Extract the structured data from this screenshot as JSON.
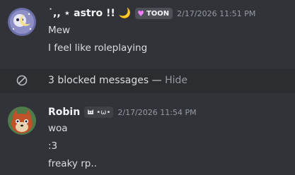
{
  "messages": [
    {
      "username": "˙,, ⋆ astro !! 🌙",
      "tag": "TOON",
      "timestamp": "2/17/2026 11:51 PM",
      "lines": [
        "Mew",
        "I feel like roleplaying"
      ]
    },
    {
      "username": "Robin",
      "tag": "•ω•",
      "timestamp": "2/17/2026 11:54 PM",
      "lines": [
        "woa",
        ":3",
        "freaky rp.."
      ]
    }
  ],
  "blocked": {
    "text": "3 blocked messages —",
    "action": "Hide"
  },
  "colors": {
    "background": "#313338",
    "username": "#f2f3f5",
    "timestamp": "#949ba4",
    "toon_heart": "#f47fff"
  }
}
